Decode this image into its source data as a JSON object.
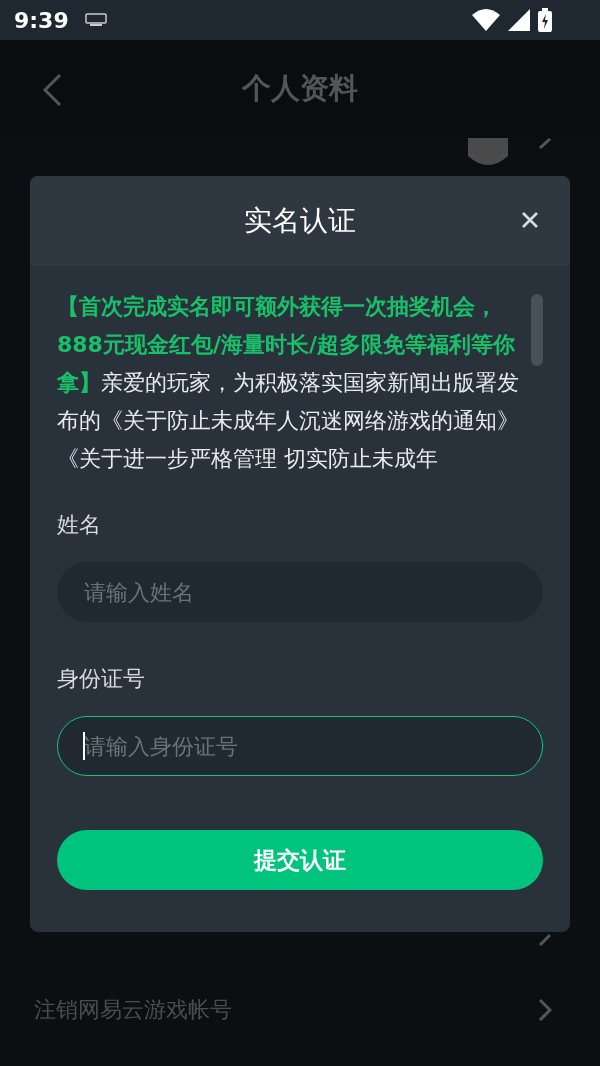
{
  "status_bar": {
    "time": "9:39"
  },
  "header": {
    "title": "个人资料"
  },
  "background_rows": [
    {
      "kind": "avatar"
    },
    {
      "kind": "plain"
    },
    {
      "kind": "text",
      "label": "注销网易云游戏帐号"
    }
  ],
  "dialog": {
    "title": "实名认证",
    "notice": "**【首次完成实名即可额外获得一次抽奖机会，888元现金红包/海量时长/超多限免等福利等你拿】**亲爱的玩家，为积极落实国家新闻出版署发布的《关于防止未成年人沉迷网络游戏的通知》《关于进一步严格管理 切实防止未成年",
    "fields": [
      {
        "label": "姓名",
        "placeholder": "请输入姓名",
        "focused": false
      },
      {
        "label": "身份证号",
        "placeholder": "请输入身份证号",
        "focused": true
      }
    ],
    "submit": "提交认证"
  }
}
